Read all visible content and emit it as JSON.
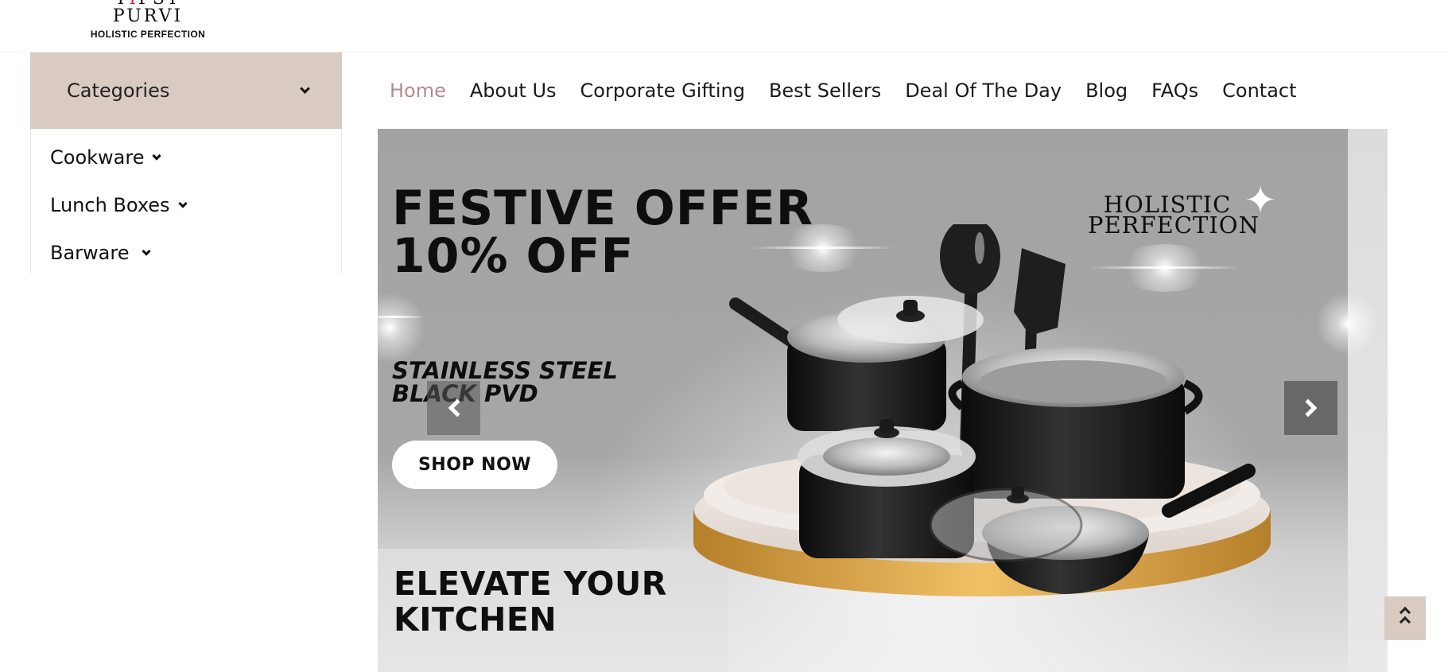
{
  "logo": {
    "word_start": "T",
    "word_red": "I",
    "word_end": "PST PURVI",
    "tagline": "HOLISTIC PERFECTION"
  },
  "categories": {
    "title": "Categories",
    "items": [
      {
        "label": "Cookware"
      },
      {
        "label": "Lunch Boxes"
      },
      {
        "label": "Barware"
      }
    ]
  },
  "nav": {
    "links": [
      {
        "label": "Home",
        "active": true
      },
      {
        "label": "About Us"
      },
      {
        "label": "Corporate Gifting"
      },
      {
        "label": "Best Sellers"
      },
      {
        "label": "Deal Of The Day"
      },
      {
        "label": "Blog"
      },
      {
        "label": "FAQs"
      },
      {
        "label": "Contact"
      }
    ]
  },
  "hero": {
    "title_line1": "FESTIVE OFFER",
    "title_line2": "10% OFF",
    "subtitle_line1": "STAINLESS STEEL",
    "subtitle_line2": "BLACK PVD",
    "cta": "SHOP NOW",
    "bottom_line1": "ELEVATE YOUR",
    "bottom_line2": "KITCHEN",
    "brand_line1": "HOLISTIC",
    "brand_line2": "PERFECTION"
  },
  "colors": {
    "accent": "#d9cbc1",
    "nav_active": "#b58a92",
    "banner_bg": "#a5a5a5"
  },
  "icons": {
    "category_toggle": "chevron-down-icon",
    "slider_prev": "chevron-left-icon",
    "slider_next": "chevron-right-icon",
    "back_to_top": "double-chevron-up-icon"
  }
}
